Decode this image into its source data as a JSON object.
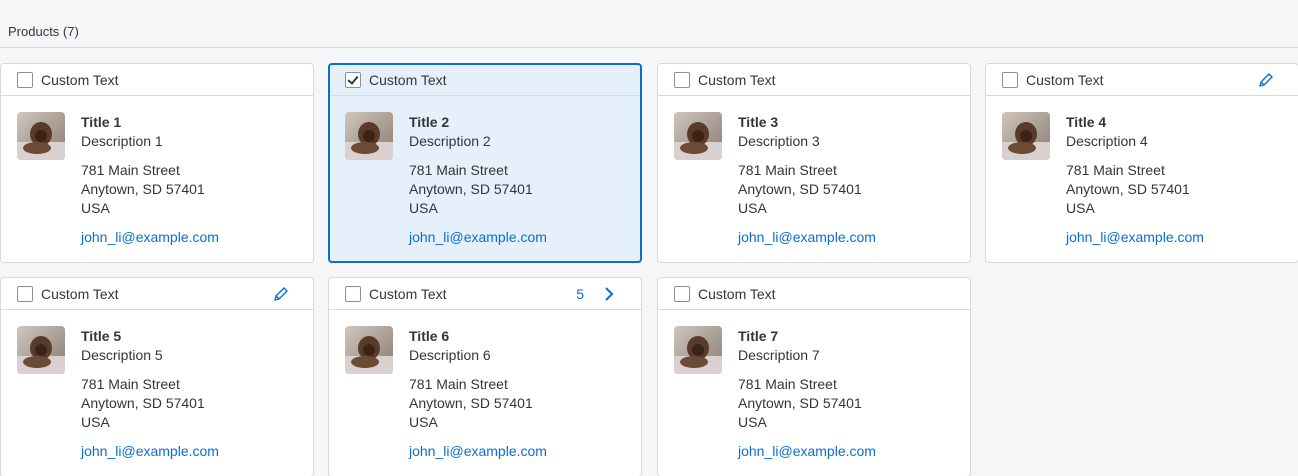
{
  "header": {
    "title": "Products (7)"
  },
  "cards": [
    {
      "header_label": "Custom Text",
      "checked": false,
      "selected": false,
      "has_edit": false,
      "counter": null,
      "has_nav": false,
      "title": "Title 1",
      "description": "Description 1",
      "address": [
        "781 Main Street",
        "Anytown, SD 57401",
        "USA"
      ],
      "email": "john_li@example.com"
    },
    {
      "header_label": "Custom Text",
      "checked": true,
      "selected": true,
      "has_edit": false,
      "counter": null,
      "has_nav": false,
      "title": "Title 2",
      "description": "Description 2",
      "address": [
        "781 Main Street",
        "Anytown, SD 57401",
        "USA"
      ],
      "email": "john_li@example.com"
    },
    {
      "header_label": "Custom Text",
      "checked": false,
      "selected": false,
      "has_edit": false,
      "counter": null,
      "has_nav": false,
      "title": "Title 3",
      "description": "Description 3",
      "address": [
        "781 Main Street",
        "Anytown, SD 57401",
        "USA"
      ],
      "email": "john_li@example.com"
    },
    {
      "header_label": "Custom Text",
      "checked": false,
      "selected": false,
      "has_edit": true,
      "counter": null,
      "has_nav": false,
      "title": "Title 4",
      "description": "Description 4",
      "address": [
        "781 Main Street",
        "Anytown, SD 57401",
        "USA"
      ],
      "email": "john_li@example.com"
    },
    {
      "header_label": "Custom Text",
      "checked": false,
      "selected": false,
      "has_edit": true,
      "counter": null,
      "has_nav": false,
      "title": "Title 5",
      "description": "Description 5",
      "address": [
        "781 Main Street",
        "Anytown, SD 57401",
        "USA"
      ],
      "email": "john_li@example.com"
    },
    {
      "header_label": "Custom Text",
      "checked": false,
      "selected": false,
      "has_edit": false,
      "counter": "5",
      "has_nav": true,
      "title": "Title 6",
      "description": "Description 6",
      "address": [
        "781 Main Street",
        "Anytown, SD 57401",
        "USA"
      ],
      "email": "john_li@example.com"
    },
    {
      "header_label": "Custom Text",
      "checked": false,
      "selected": false,
      "has_edit": false,
      "counter": null,
      "has_nav": false,
      "title": "Title 7",
      "description": "Description 7",
      "address": [
        "781 Main Street",
        "Anytown, SD 57401",
        "USA"
      ],
      "email": "john_li@example.com"
    }
  ],
  "colors": {
    "accent": "#0a6ed1",
    "selected_bg": "#e5f0fa",
    "border": "#d9d9d9",
    "text": "#32363a",
    "page_bg": "#f5f6f7"
  },
  "icons": {
    "edit": "pencil-icon",
    "navigation": "chevron-right-icon",
    "thumbnail": "product-photo"
  }
}
